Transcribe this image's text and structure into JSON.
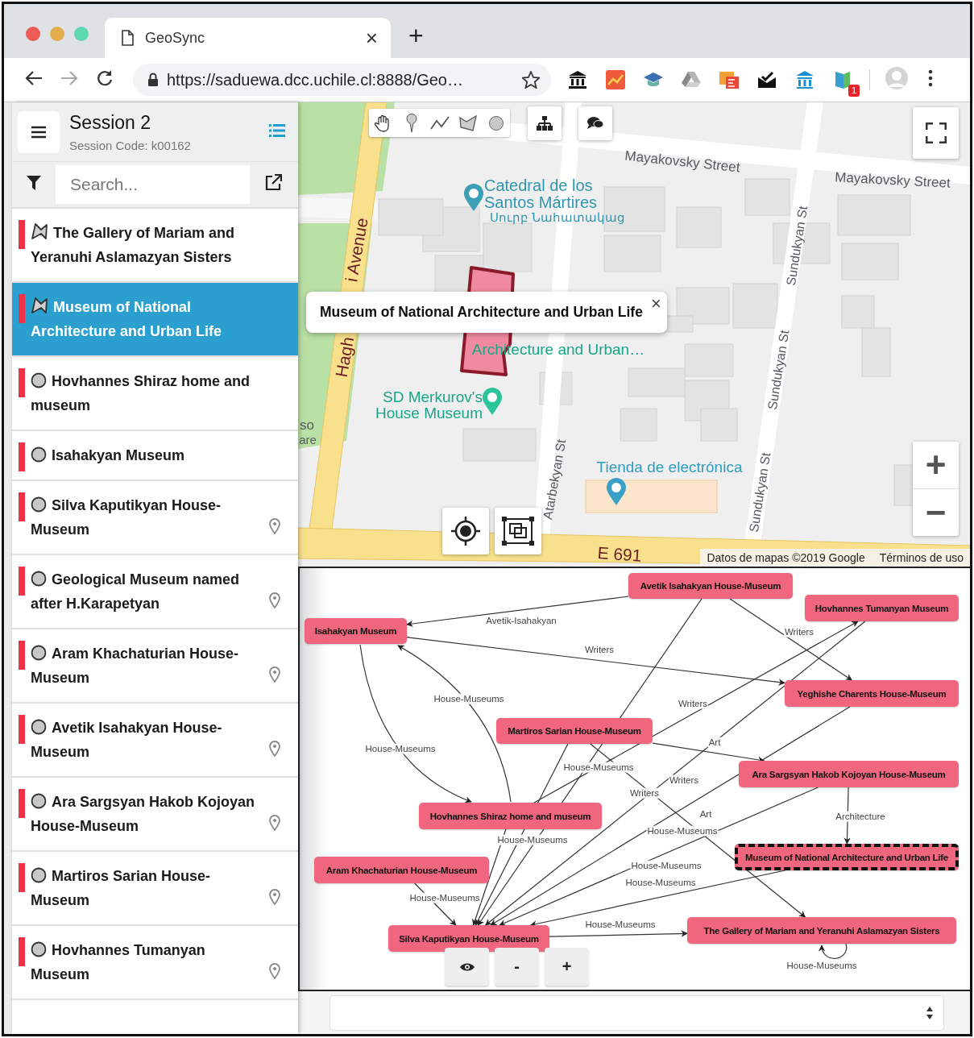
{
  "browser": {
    "tab": {
      "title": "GeoSync",
      "close": "×"
    },
    "new_tab": "+",
    "url": "https://saduewa.dcc.uchile.cl:8888/Geo…",
    "forward_disabled": true,
    "extension_badge": "1"
  },
  "session": {
    "title": "Session 2",
    "code": "Session Code: k00162"
  },
  "search": {
    "placeholder": "Search..."
  },
  "places": [
    {
      "name": "The Gallery of Mariam and Yeranuhi Aslamazyan Sisters",
      "kind": "area",
      "selected": false,
      "located": false
    },
    {
      "name": "Museum of National Architecture and Urban Life",
      "kind": "area",
      "selected": true,
      "located": false
    },
    {
      "name": "Hovhannes Shiraz home and museum",
      "kind": "point",
      "selected": false,
      "located": false
    },
    {
      "name": "Isahakyan Museum",
      "kind": "point",
      "selected": false,
      "located": false
    },
    {
      "name": "Silva Kaputikyan House-Museum",
      "kind": "point",
      "selected": false,
      "located": true
    },
    {
      "name": "Geological Museum named after H.Karapetyan",
      "kind": "point",
      "selected": false,
      "located": true
    },
    {
      "name": "Aram Khachaturian House-Museum",
      "kind": "point",
      "selected": false,
      "located": true
    },
    {
      "name": "Avetik Isahakyan House-Museum",
      "kind": "point",
      "selected": false,
      "located": true
    },
    {
      "name": "Ara Sargsyan Hakob Kojoyan House-Museum",
      "kind": "point",
      "selected": false,
      "located": true
    },
    {
      "name": "Martiros Sarian House-Museum",
      "kind": "point",
      "selected": false,
      "located": true
    },
    {
      "name": "Hovhannes Tumanyan Museum",
      "kind": "point",
      "selected": false,
      "located": true
    }
  ],
  "map": {
    "popup": {
      "title": "Museum of National Architecture and Urban Life",
      "close": "×"
    },
    "labels": [
      {
        "text": "Mayakovsky Street",
        "kind": "street"
      },
      {
        "text": "Mayakovsky Street",
        "kind": "street"
      },
      {
        "text": "Catedral de los Santos Mártires",
        "kind": "landmark"
      },
      {
        "text": "Սուրբ Նահատակաց",
        "kind": "landmark"
      },
      {
        "text": "i Avenue",
        "kind": "road"
      },
      {
        "text": "Hagh",
        "kind": "road"
      },
      {
        "text": "Architecture and Urban…",
        "kind": "museum"
      },
      {
        "text": "SD Merkurov's House Museum",
        "kind": "museum"
      },
      {
        "text": "Atarbekyan St",
        "kind": "street"
      },
      {
        "text": "Sundukyan St",
        "kind": "street"
      },
      {
        "text": "Sundukyan St",
        "kind": "street"
      },
      {
        "text": "Sundukyan St",
        "kind": "street"
      },
      {
        "text": "Tienda de electrónica",
        "kind": "shop"
      },
      {
        "text": "E 691",
        "kind": "road"
      },
      {
        "text": "so",
        "kind": "street"
      },
      {
        "text": "are",
        "kind": "street"
      }
    ],
    "zoom": [
      "+",
      "−"
    ],
    "attribution": [
      "Datos de mapas ©2019 Google",
      "Términos de uso"
    ]
  },
  "graph": {
    "nodes": [
      {
        "label": "Avetik Isahakyan House-Museum",
        "selected": false
      },
      {
        "label": "Hovhannes Tumanyan Museum",
        "selected": false
      },
      {
        "label": "Isahakyan Museum",
        "selected": false
      },
      {
        "label": "Yeghishe Charents House-Museum",
        "selected": false
      },
      {
        "label": "Martiros Sarian House-Museum",
        "selected": false
      },
      {
        "label": "Ara Sargsyan Hakob Kojoyan House-Museum",
        "selected": false
      },
      {
        "label": "Hovhannes Shiraz home and museum",
        "selected": false
      },
      {
        "label": "Museum of National Architecture and Urban Life",
        "selected": true
      },
      {
        "label": "Aram Khachaturian House-Museum",
        "selected": false
      },
      {
        "label": "Silva Kaputikyan House-Museum",
        "selected": false
      },
      {
        "label": "The Gallery of Mariam and Yeranuhi Aslamazyan Sisters",
        "selected": false
      }
    ],
    "edges": [
      {
        "label": "Avetik-Isahakyan"
      },
      {
        "label": "Writers"
      },
      {
        "label": "Writers"
      },
      {
        "label": "Writers"
      },
      {
        "label": "Art"
      },
      {
        "label": "House-Museums"
      },
      {
        "label": "House-Museums"
      },
      {
        "label": "House-Museums"
      },
      {
        "label": "Writers"
      },
      {
        "label": "Writers"
      },
      {
        "label": "Art"
      },
      {
        "label": "House-Museums"
      },
      {
        "label": "House-Museums"
      },
      {
        "label": "House-Museums"
      },
      {
        "label": "House-Museums"
      },
      {
        "label": "House-Museums"
      },
      {
        "label": "House-Museums"
      },
      {
        "label": "Architecture"
      },
      {
        "label": "House-Museums"
      }
    ],
    "controls": [
      "-",
      "+"
    ]
  }
}
